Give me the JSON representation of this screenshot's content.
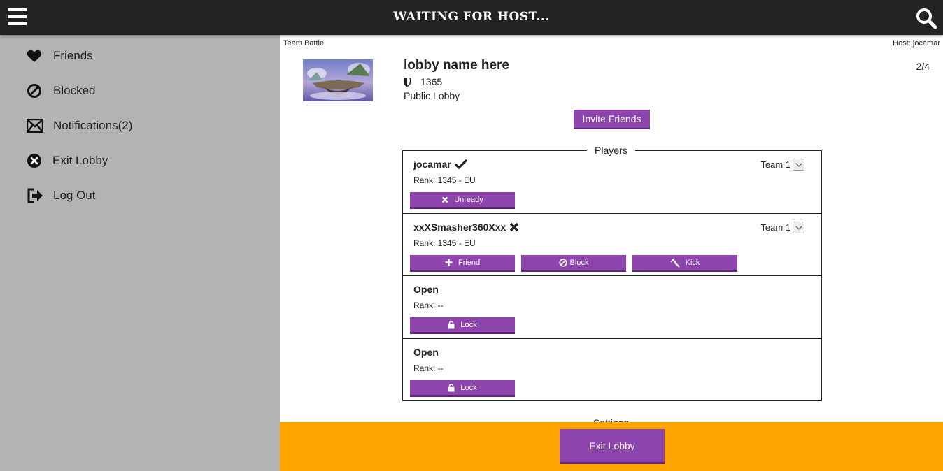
{
  "header": {
    "title": "WAITING FOR HOST...",
    "menu_icon": "hamburger-menu-icon",
    "search_icon": "search-icon"
  },
  "sidebar": {
    "items": [
      {
        "label": "Friends",
        "icon": "heart-icon"
      },
      {
        "label": "Blocked",
        "icon": "blocked-icon"
      },
      {
        "label": "Notifications(2)",
        "icon": "envelope-icon"
      },
      {
        "label": "Exit Lobby",
        "icon": "close-circle-icon"
      },
      {
        "label": "Log Out",
        "icon": "logout-icon"
      }
    ]
  },
  "lobby": {
    "mode": "Team Battle",
    "host": "Host: jocamar",
    "name": "lobby name here",
    "rank": "1365",
    "visibility": "Public Lobby",
    "player_count": "2/4",
    "invite_label": "Invite Friends",
    "players_legend": "Players",
    "settings_label": "Settings"
  },
  "players": [
    {
      "name": "jocamar",
      "status_icon": "check-icon",
      "rank": "Rank: 1345 - EU",
      "team": "Team 1",
      "actions": [
        {
          "label": "Unready",
          "icon": "x-icon"
        }
      ]
    },
    {
      "name": "xxXSmasher360Xxx",
      "status_icon": "x-icon",
      "rank": "Rank: 1345 - EU",
      "team": "Team 1",
      "actions": [
        {
          "label": "Friend",
          "icon": "plus-icon"
        },
        {
          "label": "Block",
          "icon": "blocked-icon"
        },
        {
          "label": "Kick",
          "icon": "hammer-icon"
        }
      ]
    },
    {
      "name": "Open",
      "rank": "Rank: --",
      "actions": [
        {
          "label": "Lock",
          "icon": "lock-icon"
        }
      ]
    },
    {
      "name": "Open",
      "rank": "Rank: --",
      "actions": [
        {
          "label": "Lock",
          "icon": "lock-icon"
        }
      ]
    }
  ],
  "footer": {
    "exit_label": "Exit Lobby"
  },
  "colors": {
    "topbar": "#232323",
    "sidebar": "#b3b3b3",
    "accent": "#8e44ad",
    "footer": "#ffa500"
  }
}
